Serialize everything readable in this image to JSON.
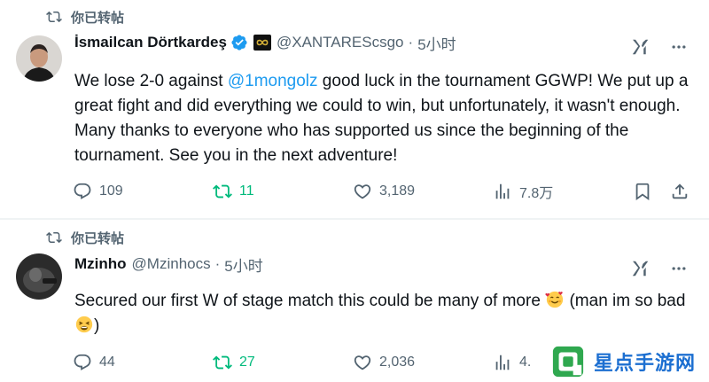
{
  "repost_label": "你已转帖",
  "tweets": [
    {
      "author": {
        "name": "İsmailcan Dörtkardeş",
        "handle": "@XANTAREScsgo",
        "time": "5小时",
        "verified": true,
        "affiliation_badge": "team-logo"
      },
      "text": {
        "before": "We lose 2-0 against ",
        "mention": "@1mongolz",
        "after": " good luck in the tournament GGWP! We put up a great fight and did everything we could to win, but unfortunately, it wasn't enough. Many thanks to everyone who has supported us since the beginning of the tournament. See you in the next adventure!"
      },
      "stats": {
        "replies": "109",
        "reposts": "11",
        "likes": "3,189",
        "views": "7.8万"
      }
    },
    {
      "author": {
        "name": "Mzinho",
        "handle": "@Mzinhocs",
        "time": "5小时",
        "verified": false
      },
      "text": {
        "before": "Secured our first W of stage match this could be many of more ",
        "emoji1": "smiling-face-with-hearts",
        "middle": " (man im so bad ",
        "emoji2": "tired-face",
        "after": ")"
      },
      "stats": {
        "replies": "44",
        "reposts": "27",
        "likes": "2,036",
        "views": "4."
      }
    }
  ],
  "watermark": {
    "text": "星点手游网"
  },
  "colors": {
    "accent": "#1d9bf0",
    "repost_green": "#00ba7c",
    "muted": "#536471",
    "text": "#0f1419"
  }
}
